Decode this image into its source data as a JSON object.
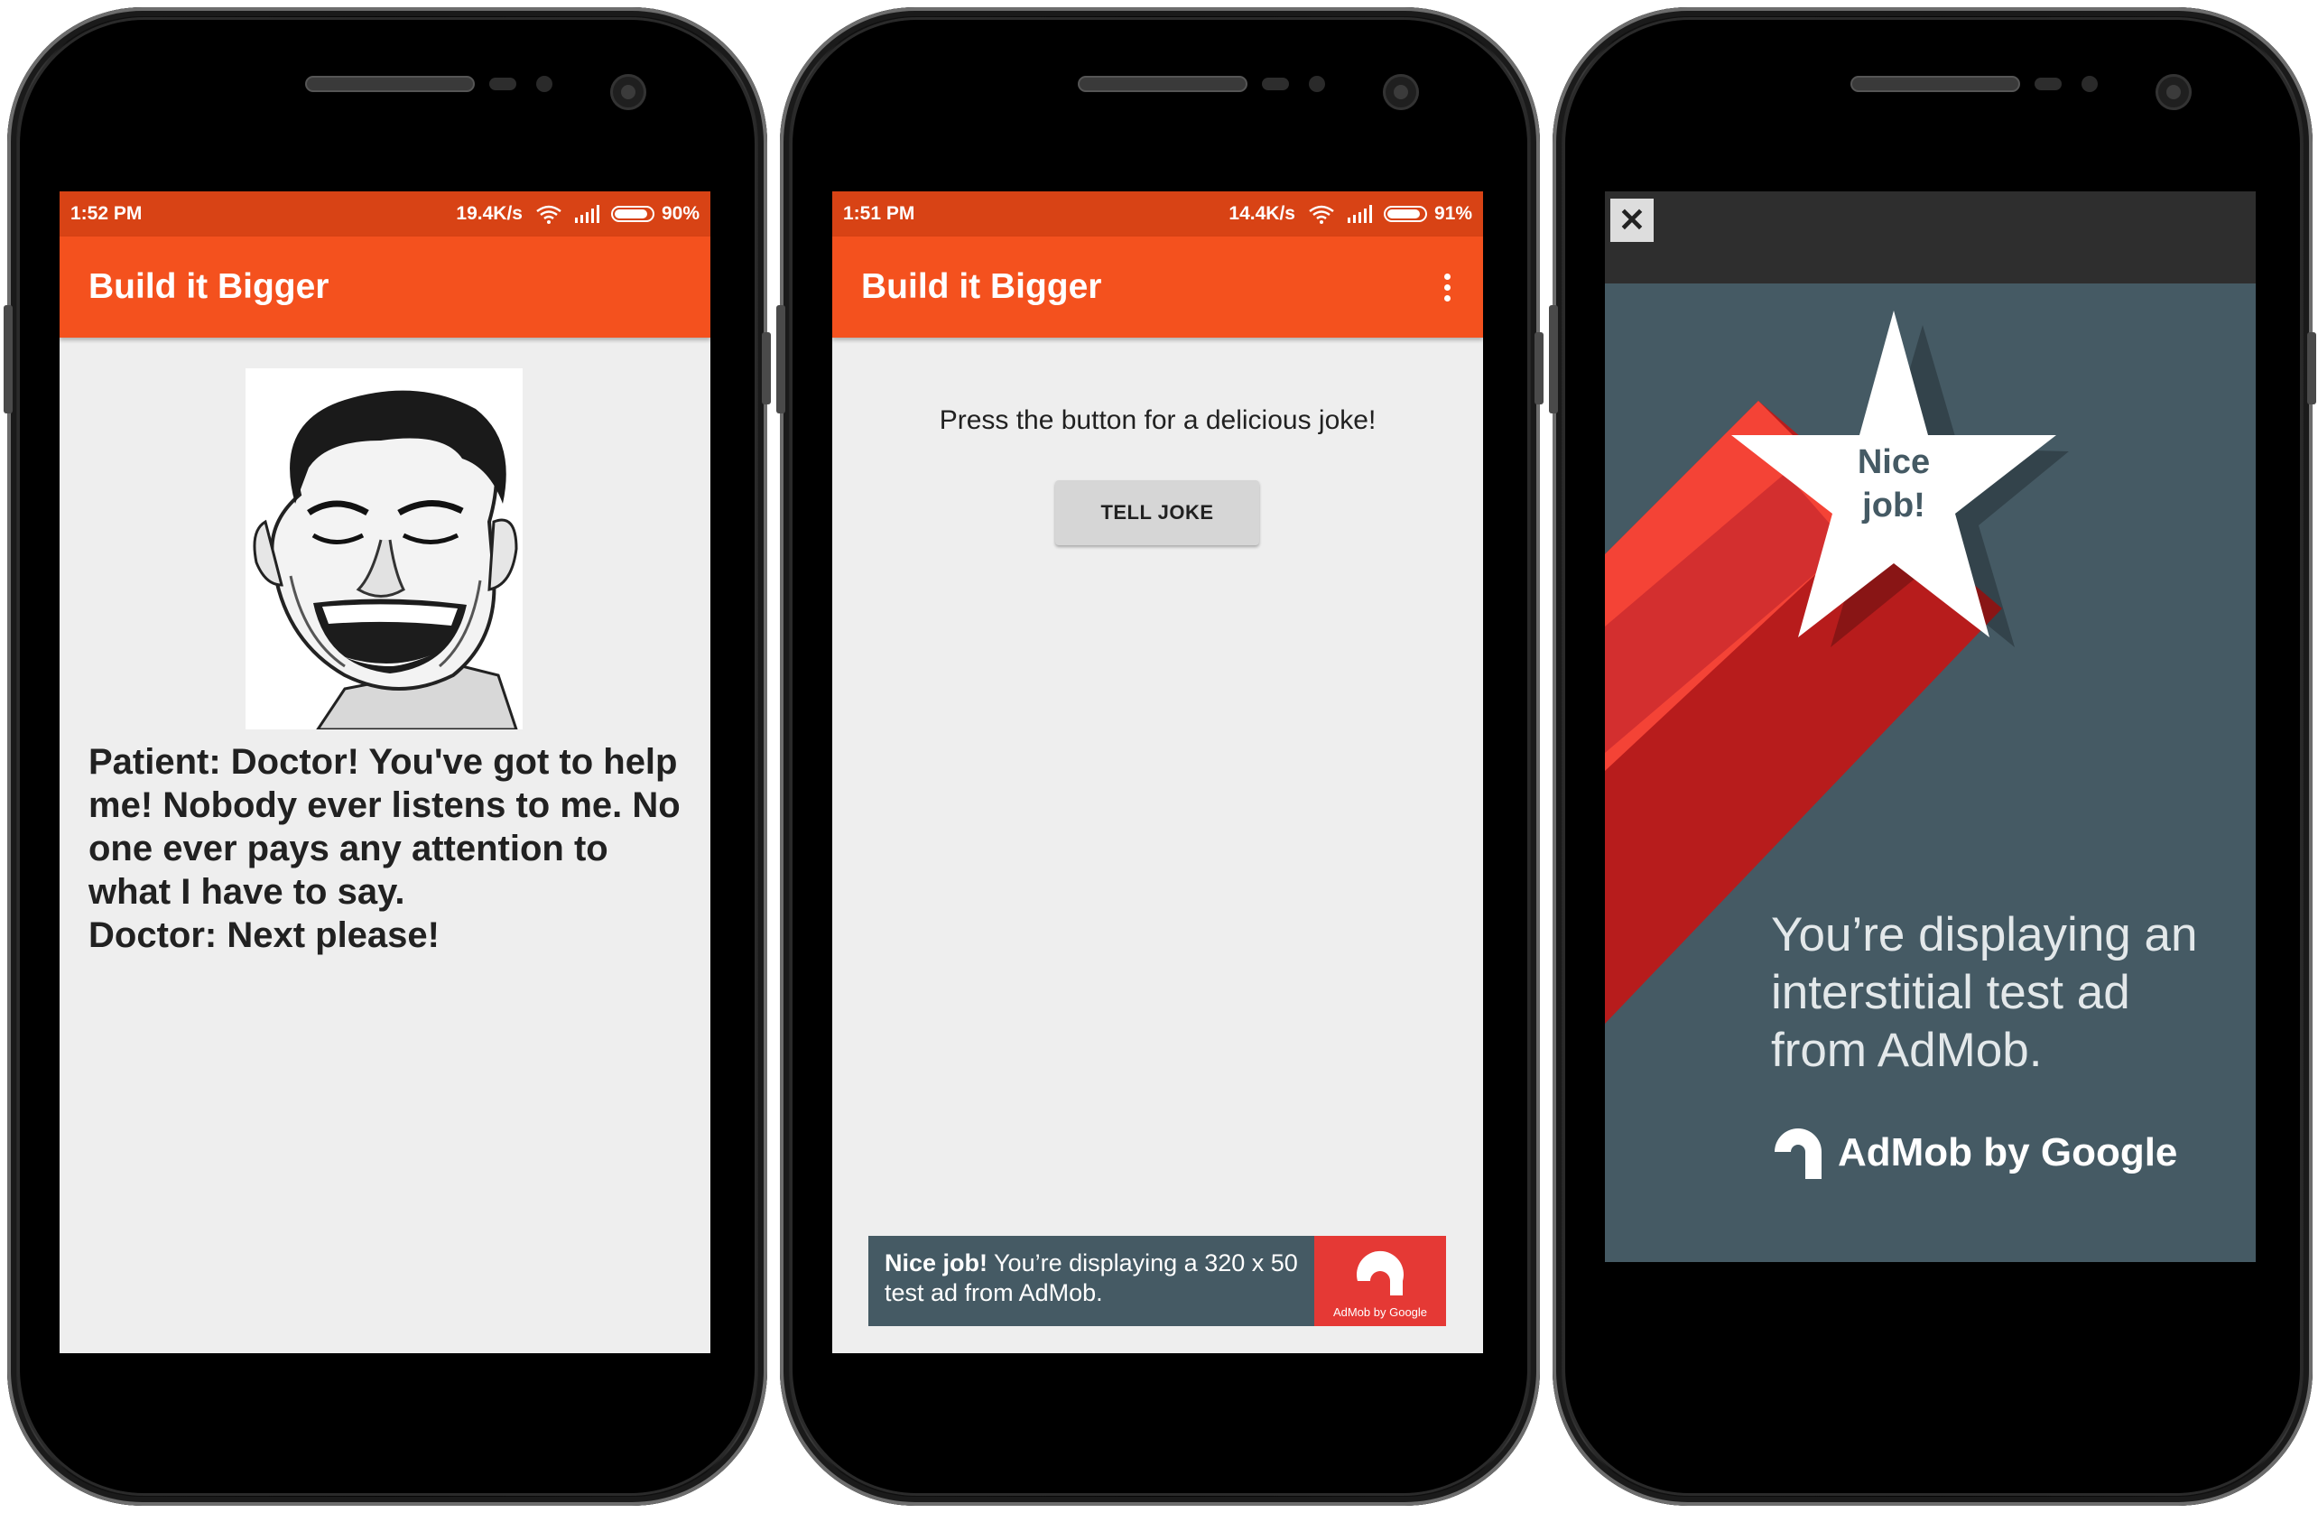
{
  "app": {
    "title": "Build it Bigger"
  },
  "screen_joke": {
    "status": {
      "time": "1:52 PM",
      "speed": "19.4K/s",
      "battery": "90%"
    },
    "joke": "Patient: Doctor! You've got to help me! Nobody ever listens to me. No one ever pays any attention to what I have to say.\nDoctor: Next please!"
  },
  "screen_main": {
    "status": {
      "time": "1:51 PM",
      "speed": "14.4K/s",
      "battery": "91%"
    },
    "prompt": "Press the button for a delicious joke!",
    "button": "TELL JOKE",
    "banner": {
      "bold": "Nice job!",
      "text": " You’re displaying a 320 x 50 test ad from AdMob.",
      "logo_caption": "AdMob by Google"
    }
  },
  "screen_interstitial": {
    "close": "✕",
    "star_text": "Nice\njob!",
    "headline": "You’re displaying an\ninterstitial test ad\nfrom AdMob.",
    "brand": "AdMob by Google"
  },
  "colors": {
    "status_bar": "#d84315",
    "app_bar": "#f4511e",
    "ad_background": "#455a64",
    "ad_red": "#e53935"
  }
}
